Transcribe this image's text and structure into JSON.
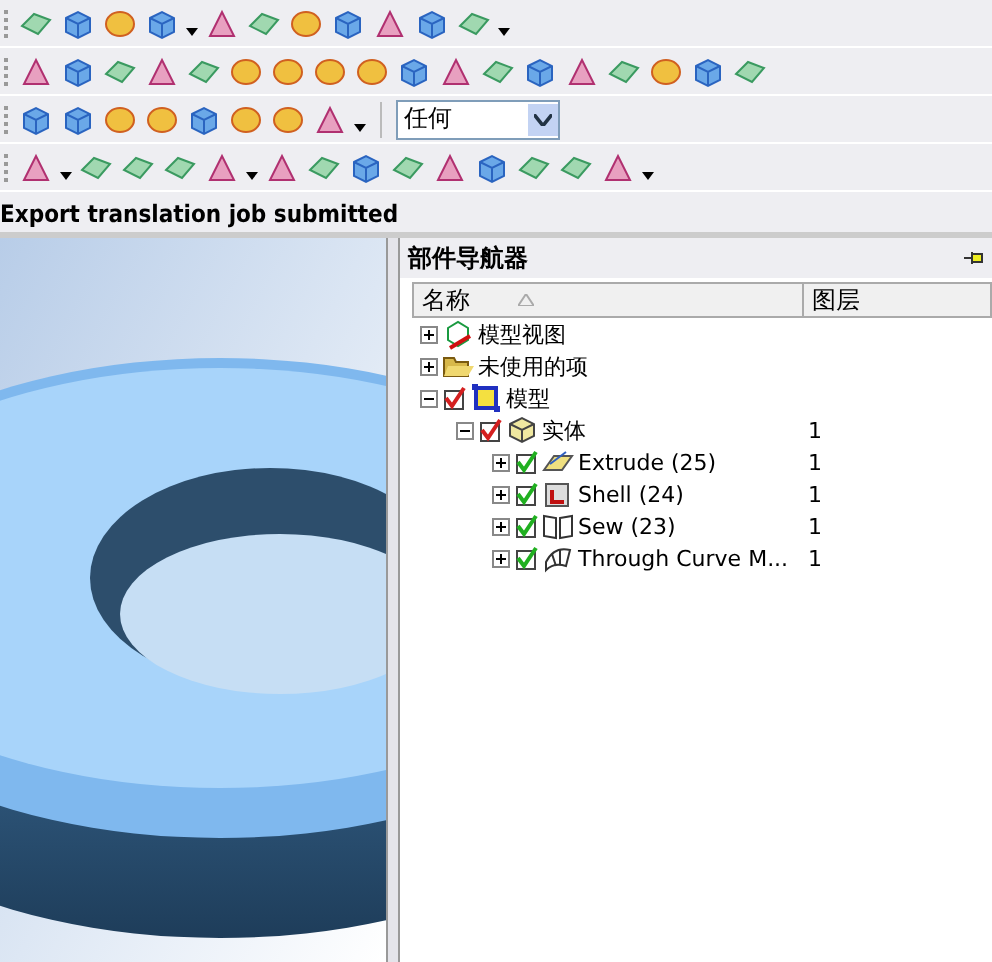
{
  "toolbar": {
    "selection_filter": {
      "value": "任何"
    }
  },
  "status_bar": {
    "message": "Export translation job submitted"
  },
  "navigator": {
    "title": "部件导航器",
    "columns": [
      {
        "label": "名称"
      },
      {
        "label": "图层"
      }
    ],
    "tree": [
      {
        "label": "模型视图",
        "kind": "view",
        "expanded": false
      },
      {
        "label": "未使用的项",
        "kind": "folder",
        "expanded": false
      },
      {
        "label": "模型",
        "kind": "model",
        "expanded": true,
        "checked": true,
        "color": "#d42020",
        "children": [
          {
            "label": "实体",
            "kind": "body",
            "expanded": true,
            "checked": true,
            "color": "#d42020",
            "layer": "1",
            "children": [
              {
                "label": "Extrude (25)",
                "kind": "extrude",
                "expanded": false,
                "checked": true,
                "color": "#20b020",
                "layer": "1"
              },
              {
                "label": "Shell (24)",
                "kind": "shell",
                "expanded": false,
                "checked": true,
                "color": "#20b020",
                "layer": "1"
              },
              {
                "label": "Sew (23)",
                "kind": "sew",
                "expanded": false,
                "checked": true,
                "color": "#20b020",
                "layer": "1"
              },
              {
                "label": "Through Curve M...",
                "kind": "curve",
                "expanded": false,
                "checked": true,
                "color": "#20b020",
                "layer": "1"
              }
            ]
          }
        ]
      }
    ]
  }
}
